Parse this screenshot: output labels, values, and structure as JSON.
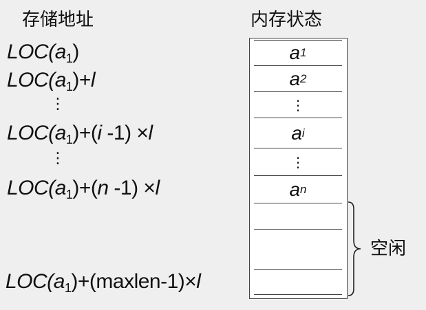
{
  "headings": {
    "address": "存储地址",
    "memory": "内存状态"
  },
  "addresses": [
    {
      "loc": "LOC(",
      "a": "a",
      "sub": "1",
      "close": ")",
      "rest": ""
    },
    {
      "loc": "LOC(",
      "a": "a",
      "sub": "1",
      "close": ")+",
      "rest": "l"
    },
    {
      "dots": "⋮"
    },
    {
      "loc": "LOC(",
      "a": "a",
      "sub": "1",
      "close": ")+(",
      "var": "i",
      "mid": " -1) ×",
      "rest": "l"
    },
    {
      "dots": "⋮"
    },
    {
      "loc": "LOC(",
      "a": "a",
      "sub": "1",
      "close": ")+(",
      "var": "n",
      "mid": " -1) ×",
      "rest": "l"
    },
    {
      "loc": "LOC(",
      "a": "a",
      "sub": "1",
      "close": ")+(maxlen-1)×",
      "rest": "l"
    }
  ],
  "cells": [
    {
      "base": "a",
      "sub": "1"
    },
    {
      "base": "a",
      "sub": "2"
    },
    {
      "dots": "⋮"
    },
    {
      "base": "a",
      "sub": "i"
    },
    {
      "dots": "⋮"
    },
    {
      "base": "a",
      "sub": "n"
    }
  ],
  "free_label": "空闲"
}
